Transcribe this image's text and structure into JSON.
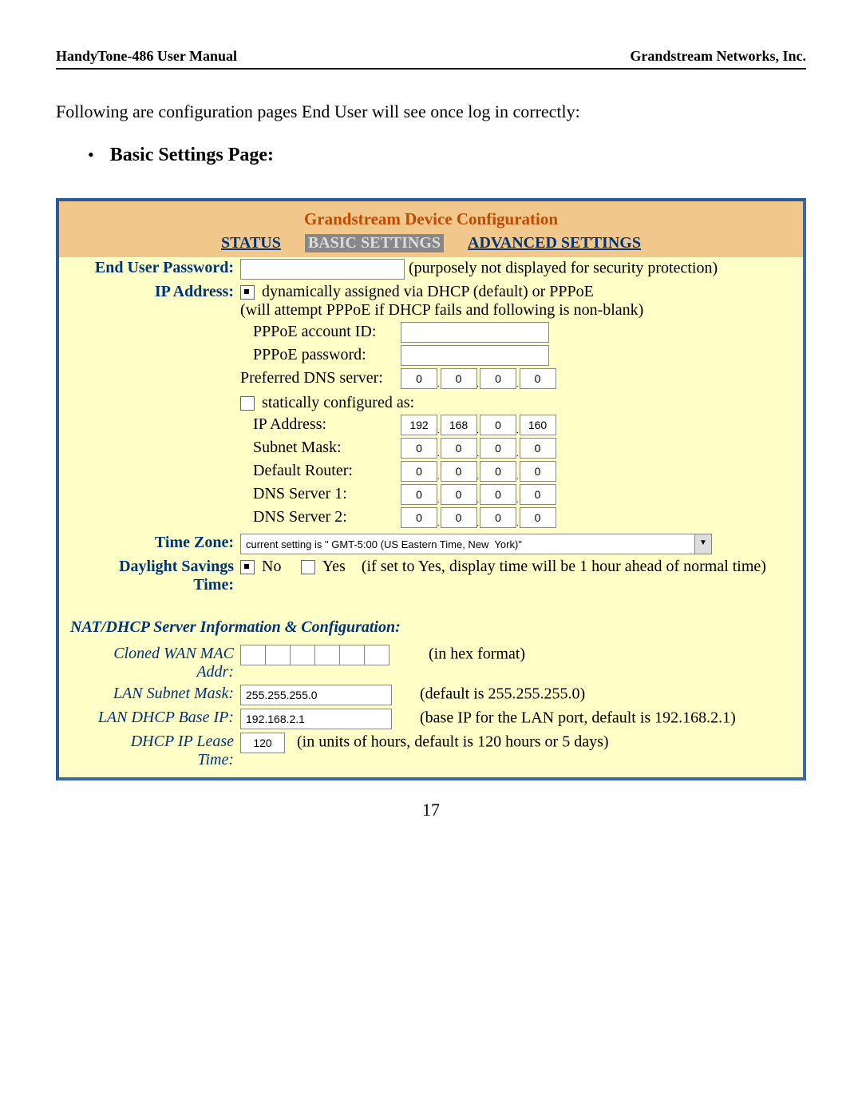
{
  "header": {
    "left": "HandyTone-486 User Manual",
    "right": "Grandstream Networks, Inc."
  },
  "intro": "Following are configuration pages End User will see once log in correctly:",
  "bullet": "Basic Settings Page:",
  "panel_title": "Grandstream Device Configuration",
  "tabs": {
    "status": "STATUS",
    "basic": "BASIC SETTINGS",
    "advanced": "ADVANCED SETTINGS"
  },
  "fields": {
    "end_user_password_label": "End User Password:",
    "end_user_password_note": "(purposely not displayed for security protection)",
    "ip_address_label": "IP Address:",
    "dhcp_text1": "dynamically assigned via DHCP (default) or PPPoE",
    "dhcp_text2": "(will attempt PPPoE if DHCP fails and following is non-blank)",
    "pppoe_account_label": "PPPoE account ID:",
    "pppoe_password_label": "PPPoE password:",
    "preferred_dns_label": "Preferred DNS server:",
    "preferred_dns": [
      "0",
      "0",
      "0",
      "0"
    ],
    "static_text": "statically configured as:",
    "static_ip_label": "IP Address:",
    "static_ip": [
      "192",
      "168",
      "0",
      "160"
    ],
    "subnet_label": "Subnet Mask:",
    "subnet": [
      "0",
      "0",
      "0",
      "0"
    ],
    "router_label": "Default Router:",
    "router": [
      "0",
      "0",
      "0",
      "0"
    ],
    "dns1_label": "DNS Server 1:",
    "dns1": [
      "0",
      "0",
      "0",
      "0"
    ],
    "dns2_label": "DNS Server 2:",
    "dns2": [
      "0",
      "0",
      "0",
      "0"
    ],
    "timezone_label": "Time Zone:",
    "timezone_value": "current setting is \" GMT-5:00 (US Eastern Time, New  York)\"",
    "dst_label1": "Daylight Savings",
    "dst_label2": "Time:",
    "dst_no": "No",
    "dst_yes": "Yes",
    "dst_note": "(if set to Yes, display time will be 1 hour ahead of normal time)",
    "nat_header": "NAT/DHCP Server Information & Configuration:",
    "cloned_mac_label1": "Cloned WAN MAC",
    "cloned_mac_label2": "Addr:",
    "cloned_mac_note": "(in hex format)",
    "lan_subnet_label": "LAN Subnet Mask:",
    "lan_subnet_value": "255.255.255.0",
    "lan_subnet_note": "(default is 255.255.255.0)",
    "lan_base_label": "LAN DHCP Base IP:",
    "lan_base_value": "192.168.2.1",
    "lan_base_note": "(base IP for the LAN port, default is 192.168.2.1)",
    "lease_label1": "DHCP IP Lease",
    "lease_label2": "Time:",
    "lease_value": "120",
    "lease_note": "(in units of hours, default is 120 hours or 5 days)"
  },
  "page_num": "17"
}
